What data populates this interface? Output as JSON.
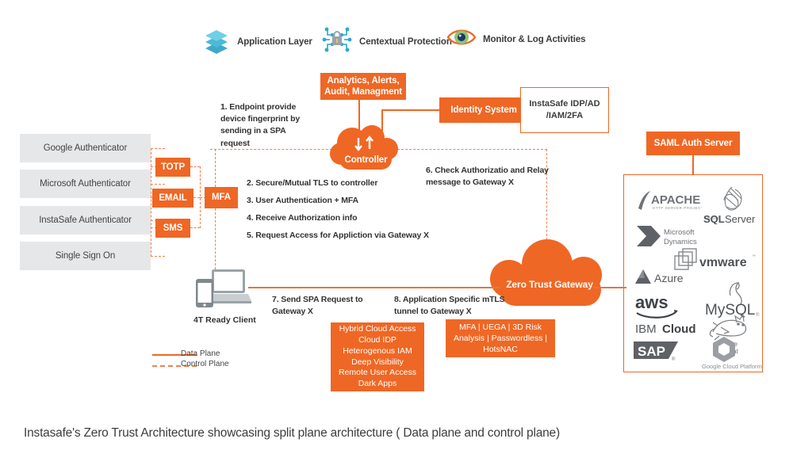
{
  "diagram": {
    "top_legend": [
      {
        "icon": "layers-icon",
        "label": "Application Layer"
      },
      {
        "icon": "lock-network-icon",
        "label": "Centextual Protection"
      },
      {
        "icon": "eye-icon",
        "label": "Monitor & Log Activities"
      }
    ],
    "authenticators": [
      "Google Authenticator",
      "Microsoft Authenticator",
      "InstaSafe Authenticator",
      "Single Sign On"
    ],
    "mfa_methods": [
      "TOTP",
      "EMAIL",
      "SMS"
    ],
    "mfa_label": "MFA",
    "analytics_box": "Analytics, Alerts, Audit, Managment",
    "identity_system": "Identity System",
    "instasafe_idp": "InstaSafe IDP/AD /IAM/2FA",
    "saml_auth_server": "SAML Auth Server",
    "controller": "Controller",
    "gateway": "Zero Trust Gateway",
    "client_label": "4T Ready Client",
    "steps": [
      "1. Endpoint provide device fingerprint by sending in a SPA request",
      "2. Secure/Mutual TLS to controller",
      "3. User Authentication + MFA",
      "4. Receive Authorization info",
      "5. Request Access for Appliction via Gateway X",
      "6. Check Authorizatio and Relay message to Gateway X",
      "7.  Send SPA Request to Gateway X",
      "8.  Application Specific mTLS tunnel to Gateway X"
    ],
    "feature_box_left": [
      "Hybrid Cloud Access",
      "Cloud IDP",
      "Heterogenous IAM",
      "Deep Visibility",
      "Remote User Access",
      "Dark Apps"
    ],
    "feature_box_right": "MFA | UEGA | 3D Risk Analysis | Passwordless | HotsNAC",
    "app_logos": [
      "APACHE HTTP SERVER PROJECT",
      "Microsoft SQL Server",
      "Microsoft Dynamics",
      "vmware",
      "Azure",
      "aws",
      "MySQL",
      "IBM Cloud",
      "Apache Tomcat",
      "SAP",
      "Google Cloud Platform"
    ],
    "plane_legend": [
      {
        "style": "solid",
        "label": "Data Plane"
      },
      {
        "style": "dashed",
        "label": "Control Plane"
      }
    ],
    "caption": "Instasafe's Zero Trust Architecture showcasing split plane architecture ( Data plane and control plane)",
    "colors": {
      "orange": "#ef6724",
      "orange_dash": "#f08050",
      "gray_box": "#e6e7e8",
      "text": "#3c3c3c",
      "layers_icon": "#5bc4dd",
      "lock_icon": "#2aa9c9",
      "eye_icon": "#ed6a2a"
    }
  }
}
